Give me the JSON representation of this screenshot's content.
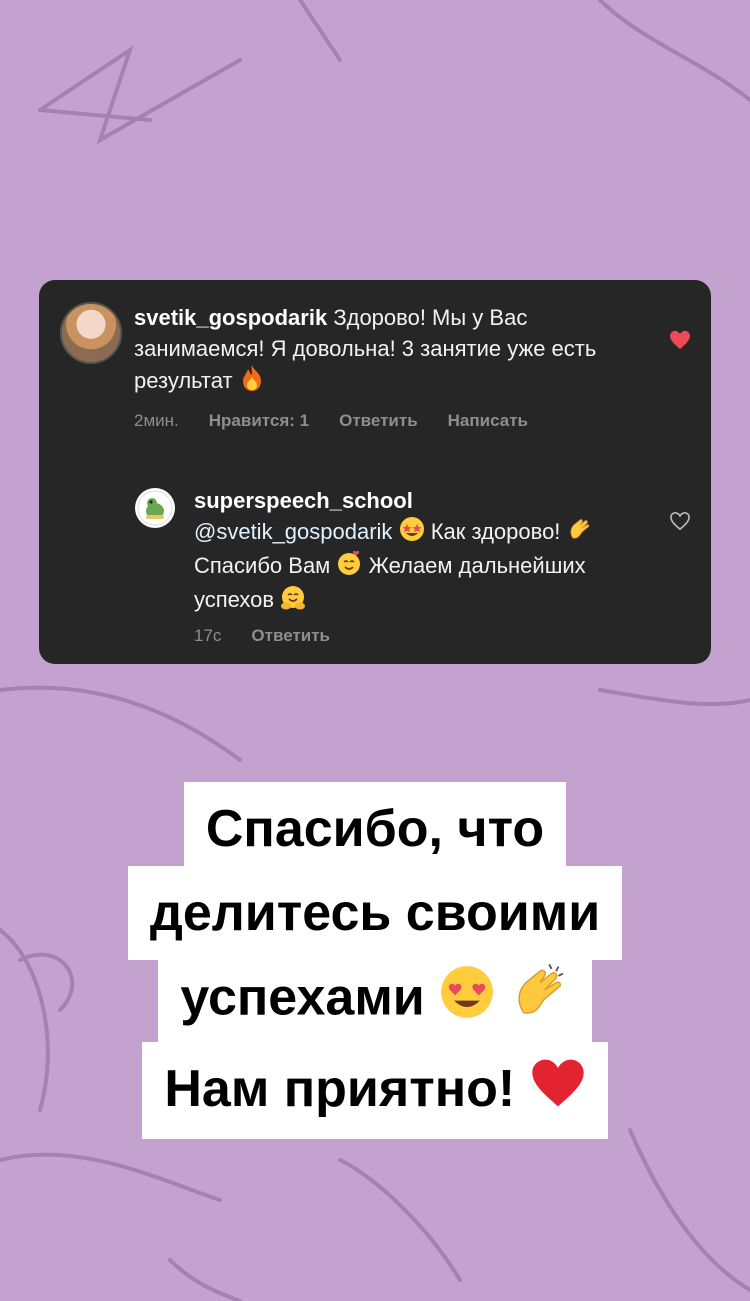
{
  "colors": {
    "background": "#c4a2cf",
    "card": "#262626",
    "meta_text": "#8e8e8e",
    "heart_red": "#ed4956",
    "caption_bg": "#ffffff"
  },
  "comment": {
    "username": "svetik_gospodarik",
    "text": "Здорово! Мы у Вас занимаемся! Я довольна! 3 занятие уже есть результат",
    "emoji": "fire-emoji",
    "time": "2мин.",
    "likes_label": "Нравится: 1",
    "reply_label": "Ответить",
    "write_label": "Написать",
    "liked": true
  },
  "reply": {
    "username": "superspeech_school",
    "mention": "@svetik_gospodarik",
    "part1": "Как здорово!",
    "part2": "Спасибо Вам",
    "part3": "Желаем дальнейших успехов",
    "time": "17с",
    "reply_label": "Ответить",
    "liked": false
  },
  "caption": {
    "line1": "Спасибо, что",
    "line2": "делитесь своими",
    "line3": "успехами",
    "line4": "Нам приятно!"
  }
}
